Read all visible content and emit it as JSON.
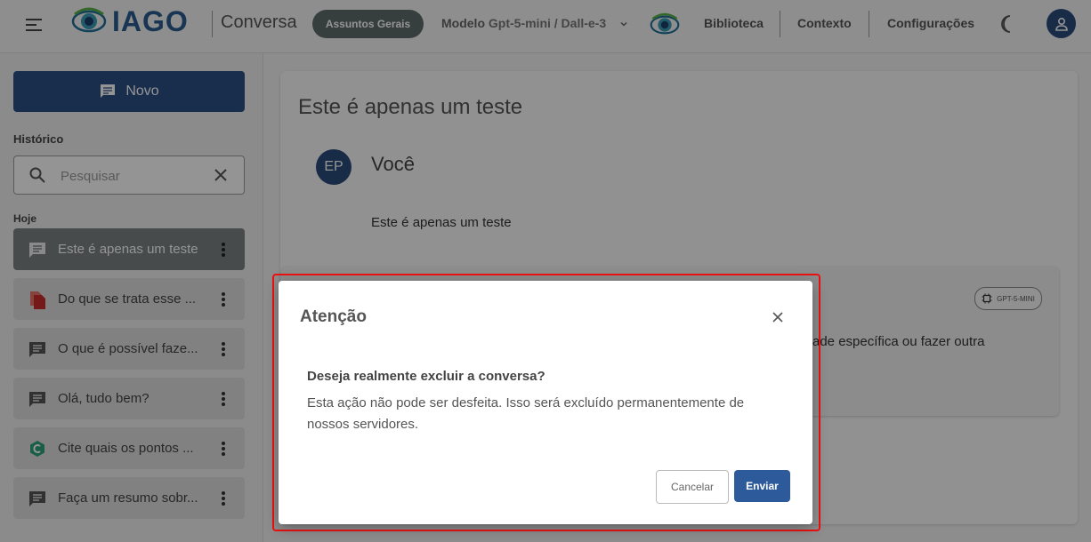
{
  "header": {
    "logo_text": "IAGO",
    "app_title": "Conversa",
    "category_pill": "Assuntos Gerais",
    "model_label": "Modelo",
    "model_value": "Gpt-5-mini / Dall-e-3",
    "nav": [
      "Biblioteca",
      "Contexto",
      "Configurações"
    ],
    "icons": {
      "menu": "hamburger-icon",
      "theme": "moon-icon",
      "account": "person-icon",
      "model_dropdown": "chevron-down-icon"
    }
  },
  "sidebar": {
    "new_button_label": "Novo",
    "history_label": "Histórico",
    "search": {
      "placeholder": "Pesquisar",
      "value": ""
    },
    "today_label": "Hoje",
    "items": [
      {
        "label": "Este é apenas um teste",
        "icon": "chat-icon",
        "active": true
      },
      {
        "label": "Do que se trata esse ...",
        "icon": "pdf-document-icon",
        "active": false
      },
      {
        "label": "O que é possível faze...",
        "icon": "chat-icon",
        "active": false
      },
      {
        "label": "Olá, tudo bem?",
        "icon": "chat-icon",
        "active": false
      },
      {
        "label": "Cite quais os pontos ...",
        "icon": "green-logo-icon",
        "active": false
      },
      {
        "label": "Faça um resumo sobr...",
        "icon": "chat-icon",
        "active": false
      }
    ]
  },
  "conversation": {
    "title": "Este é apenas um teste",
    "user_initials": "EP",
    "user_name": "Você",
    "user_message": "Este é apenas um teste",
    "model_badge": "GPT-5-MINI",
    "reply_fragment": "ade específica ou fazer outra"
  },
  "modal": {
    "title": "Atenção",
    "question": "Deseja realmente excluir a conversa?",
    "body": "Esta ação não pode ser desfeita. Isso será excluído permanentemente de nossos servidores.",
    "cancel_label": "Cancelar",
    "confirm_label": "Enviar"
  },
  "colors": {
    "primary": "#2c4f86",
    "pill": "#5d6b6b",
    "active_item": "#7a8282",
    "highlight": "#ee1111"
  }
}
